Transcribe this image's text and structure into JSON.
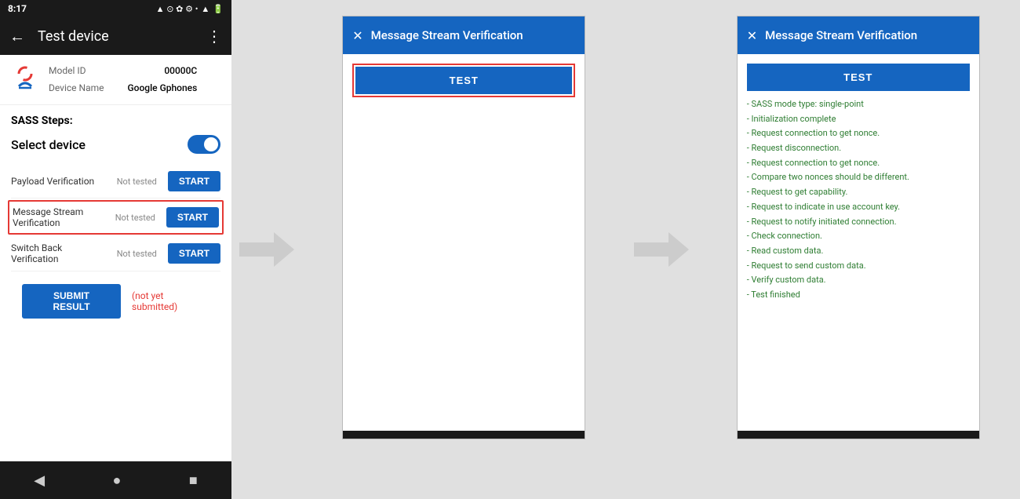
{
  "phone": {
    "status_bar": {
      "time": "8:17",
      "icons": "▲ ⊙ ✿ ⚙ •",
      "signal": "▲ 🔋"
    },
    "app_bar": {
      "title": "Test device",
      "back_label": "←",
      "more_label": "⋮"
    },
    "device": {
      "model_id_label": "Model ID",
      "model_id_value": "00000C",
      "device_name_label": "Device Name",
      "device_name_value": "Google Gphones"
    },
    "sass_title": "SASS Steps:",
    "select_device_label": "Select device",
    "steps": [
      {
        "label": "Payload Verification",
        "status": "Not tested",
        "btn": "START"
      },
      {
        "label": "Message Stream\nVerification",
        "status": "Not tested",
        "btn": "START",
        "highlighted": true
      },
      {
        "label": "Switch Back Verification",
        "status": "Not tested",
        "btn": "START"
      }
    ],
    "submit_btn": "SUBMIT RESULT",
    "not_submitted": "(not yet submitted)",
    "nav": {
      "back": "◀",
      "home": "●",
      "square": "■"
    }
  },
  "dialog1": {
    "title": "Message Stream Verification",
    "close_label": "✕",
    "test_btn": "TEST"
  },
  "dialog2": {
    "title": "Message Stream Verification",
    "close_label": "✕",
    "test_btn": "TEST",
    "log_lines": [
      "- SASS mode type: single-point",
      "- Initialization complete",
      "- Request connection to get nonce.",
      "- Request disconnection.",
      "- Request connection to get nonce.",
      "- Compare two nonces should be different.",
      "- Request to get capability.",
      "- Request to indicate in use account key.",
      "- Request to notify initiated connection.",
      "- Check connection.",
      "- Read custom data.",
      "- Request to send custom data.",
      "- Verify custom data.",
      "- Test finished"
    ]
  }
}
